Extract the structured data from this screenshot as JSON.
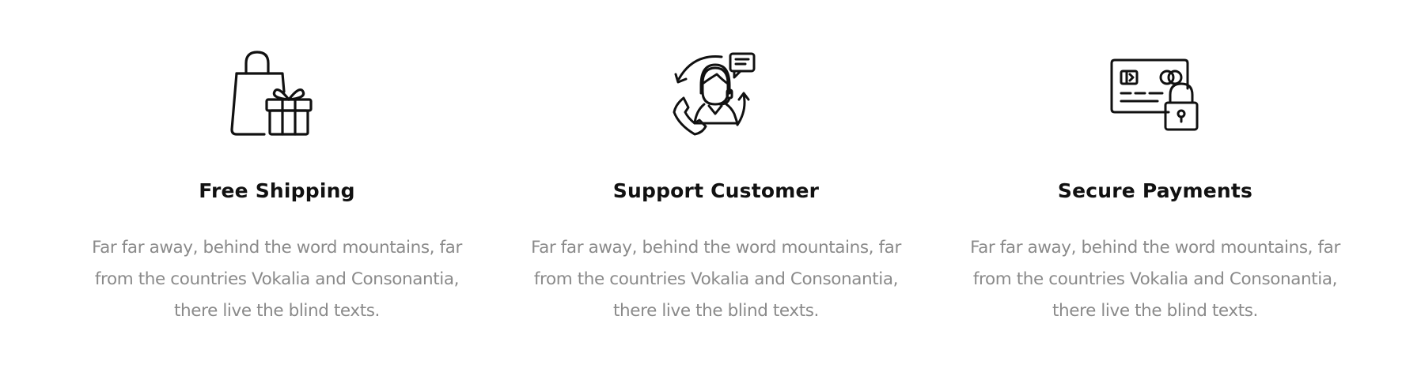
{
  "colors": {
    "background": "#ffffff",
    "title": "#111111",
    "text": "#8a8a8a",
    "icon_stroke": "#111111"
  },
  "services": [
    {
      "icon": "shopping-bag-gift-icon",
      "title": "Free Shipping",
      "description": "Far far away, behind the word mountains, far from the countries Vokalia and Consonantia, there live the blind texts."
    },
    {
      "icon": "customer-support-headset-icon",
      "title": "Support Customer",
      "description": "Far far away, behind the word mountains, far from the countries Vokalia and Consonantia, there live the blind texts."
    },
    {
      "icon": "credit-card-lock-icon",
      "title": "Secure Payments",
      "description": "Far far away, behind the word mountains, far from the countries Vokalia and Consonantia, there live the blind texts."
    }
  ]
}
